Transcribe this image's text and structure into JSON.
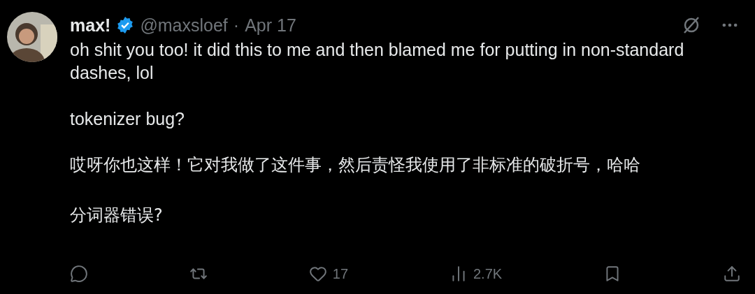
{
  "post": {
    "author": {
      "name": "max!",
      "verified": true,
      "handle": "@maxsloef",
      "separator": "·",
      "date": "Apr 17"
    },
    "paragraphs": [
      "oh shit you too! it did this to me and then blamed me for putting in non-standard dashes, lol",
      "tokenizer bug?"
    ],
    "translation": [
      "哎呀你也这样！它对我做了这件事，然后责怪我使用了非标准的破折号，哈哈",
      "分词器错误?"
    ],
    "actions": [
      {
        "kind": "reply"
      },
      {
        "kind": "repost"
      },
      {
        "kind": "like",
        "count": "17"
      },
      {
        "kind": "views",
        "count": "2.7K"
      },
      {
        "kind": "bookmark"
      },
      {
        "kind": "share"
      }
    ]
  }
}
